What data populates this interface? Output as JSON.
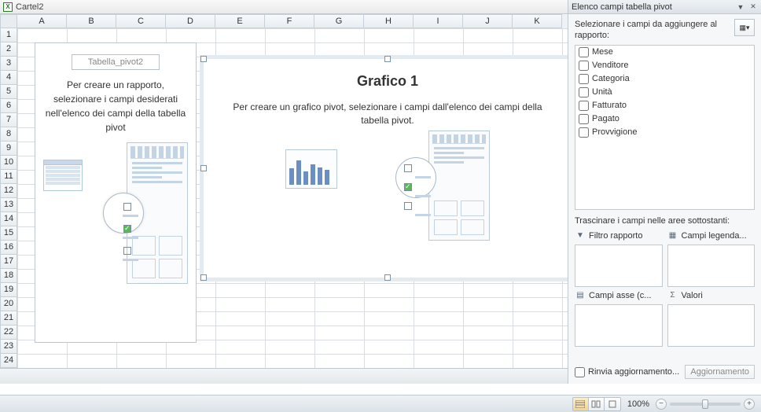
{
  "doc": {
    "title": "Cartel2"
  },
  "sheet": {
    "cols": [
      "A",
      "B",
      "C",
      "D",
      "E",
      "F",
      "G",
      "H",
      "I",
      "J",
      "K"
    ],
    "rows": [
      "1",
      "2",
      "3",
      "4",
      "5",
      "6",
      "7",
      "8",
      "9",
      "10",
      "11",
      "12",
      "13",
      "14",
      "15",
      "16",
      "17",
      "18",
      "19",
      "20",
      "21",
      "22",
      "23",
      "24"
    ]
  },
  "pivot": {
    "name": "Tabella_pivot2",
    "instruction": "Per creare un rapporto, selezionare i campi desiderati nell'elenco dei campi della tabella pivot"
  },
  "chart": {
    "title": "Grafico 1",
    "instruction": "Per creare un grafico pivot, selezionare i campi dall'elenco dei campi della tabella pivot."
  },
  "panel": {
    "title": "Elenco campi tabella pivot",
    "select_label": "Selezionare i campi da aggiungere al rapporto:",
    "fields": [
      "Mese",
      "Venditore",
      "Categoria",
      "Unità",
      "Fatturato",
      "Pagato",
      "Provvigione"
    ],
    "drag_label": "Trascinare i campi nelle aree sottostanti:",
    "zones": {
      "filter": "Filtro rapporto",
      "legend": "Campi legenda...",
      "axis": "Campi asse (c...",
      "values": "Valori"
    },
    "defer_label": "Rinvia aggiornamento...",
    "update_btn": "Aggiornamento"
  },
  "status": {
    "zoom": "100%"
  }
}
